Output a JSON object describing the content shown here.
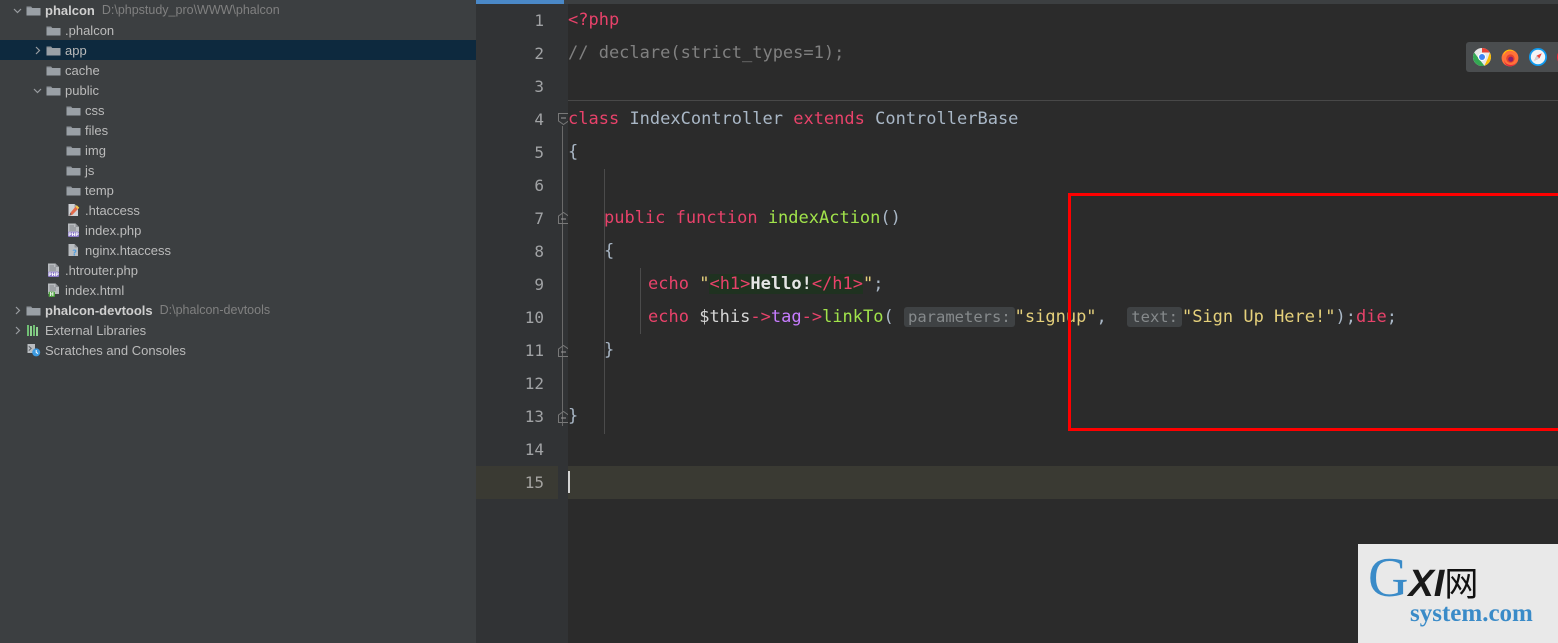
{
  "project": {
    "root": {
      "label": "phalcon",
      "path": "D:\\phpstudy_pro\\WWW\\phalcon"
    },
    "items": [
      {
        "label": ".phalcon",
        "icon": "folder-icon",
        "indent": 2,
        "twisty": "none",
        "selected": false,
        "bold": false,
        "path": ""
      },
      {
        "label": "app",
        "icon": "folder-icon",
        "indent": 2,
        "twisty": "collapsed",
        "selected": true,
        "bold": false,
        "path": ""
      },
      {
        "label": "cache",
        "icon": "folder-icon",
        "indent": 2,
        "twisty": "none",
        "selected": false,
        "bold": false,
        "path": ""
      },
      {
        "label": "public",
        "icon": "folder-icon",
        "indent": 2,
        "twisty": "expanded",
        "selected": false,
        "bold": false,
        "path": ""
      },
      {
        "label": "css",
        "icon": "folder-icon",
        "indent": 3,
        "twisty": "none",
        "selected": false,
        "bold": false,
        "path": ""
      },
      {
        "label": "files",
        "icon": "folder-icon",
        "indent": 3,
        "twisty": "none",
        "selected": false,
        "bold": false,
        "path": ""
      },
      {
        "label": "img",
        "icon": "folder-icon",
        "indent": 3,
        "twisty": "none",
        "selected": false,
        "bold": false,
        "path": ""
      },
      {
        "label": "js",
        "icon": "folder-icon",
        "indent": 3,
        "twisty": "none",
        "selected": false,
        "bold": false,
        "path": ""
      },
      {
        "label": "temp",
        "icon": "folder-icon",
        "indent": 3,
        "twisty": "none",
        "selected": false,
        "bold": false,
        "path": ""
      },
      {
        "label": ".htaccess",
        "icon": "htaccess-icon",
        "indent": 3,
        "twisty": "none",
        "selected": false,
        "bold": false,
        "path": ""
      },
      {
        "label": "index.php",
        "icon": "php-file-icon",
        "indent": 3,
        "twisty": "none",
        "selected": false,
        "bold": false,
        "path": ""
      },
      {
        "label": "nginx.htaccess",
        "icon": "unknown-file-icon",
        "indent": 3,
        "twisty": "none",
        "selected": false,
        "bold": false,
        "path": ""
      },
      {
        "label": ".htrouter.php",
        "icon": "php-file-icon",
        "indent": 2,
        "twisty": "none",
        "selected": false,
        "bold": false,
        "path": ""
      },
      {
        "label": "index.html",
        "icon": "html-file-icon",
        "indent": 2,
        "twisty": "none",
        "selected": false,
        "bold": false,
        "path": ""
      },
      {
        "label": "phalcon-devtools",
        "icon": "folder-icon",
        "indent": 1,
        "twisty": "collapsed",
        "selected": false,
        "bold": true,
        "path": "D:\\phalcon-devtools"
      },
      {
        "label": "External Libraries",
        "icon": "libraries-icon",
        "indent": 1,
        "twisty": "collapsed",
        "selected": false,
        "bold": false,
        "path": ""
      },
      {
        "label": "Scratches and Consoles",
        "icon": "scratches-icon",
        "indent": 1,
        "twisty": "none",
        "selected": false,
        "bold": false,
        "path": ""
      }
    ]
  },
  "editor": {
    "line_numbers": [
      "1",
      "2",
      "3",
      "4",
      "5",
      "6",
      "7",
      "8",
      "9",
      "10",
      "11",
      "12",
      "13",
      "14",
      "15"
    ],
    "current_line": 15,
    "code": {
      "l1_open_tag": "<?php",
      "l2_comment": "// declare(strict_types=1);",
      "l4_class_kw": "class",
      "l4_class_name": "IndexController",
      "l4_extends_kw": "extends",
      "l4_parent": "ControllerBase",
      "l5_brace": "{",
      "l7_visibility": "public",
      "l7_function_kw": "function",
      "l7_method_name": "indexAction",
      "l7_parens": "()",
      "l8_brace": "{",
      "l9_echo": "echo",
      "l9_quote_open": "\"",
      "l9_tag_open": "<h1>",
      "l9_text": "Hello!",
      "l9_tag_close": "</h1>",
      "l9_quote_close": "\"",
      "l9_semi": ";",
      "l10_echo": "echo",
      "l10_this": "$this",
      "l10_arrow1": "->",
      "l10_tag_prop": "tag",
      "l10_arrow2": "->",
      "l10_method": "linkTo",
      "l10_open_paren": "(",
      "l10_hint_parameters": "parameters:",
      "l10_arg1": "\"signup\"",
      "l10_comma": ",",
      "l10_hint_text": "text:",
      "l10_arg2": "\"Sign Up Here!\"",
      "l10_close": ");",
      "l10_die": "die",
      "l10_die_semi": ";",
      "l11_brace": "}",
      "l13_brace": "}"
    }
  },
  "run_toolbar": {
    "icons": [
      "chrome-icon",
      "firefox-icon",
      "safari-icon",
      "opera-icon"
    ]
  },
  "watermark": {
    "g": "G",
    "xi": "XI",
    "cjk": "网",
    "sub": "system.com"
  },
  "colors": {
    "accent_tab": "#4a88c7",
    "selection": "#0d293e",
    "annotation_red": "#fe0000",
    "editor_bg": "#2b2b2b",
    "gutter_bg": "#313335",
    "panel_bg": "#3c3f41",
    "keyword": "#e8426a",
    "string": "#e5d07b",
    "function": "#a1e34b",
    "comment": "#808080",
    "variable": "#c77cff",
    "current_line": "#3a3a33"
  }
}
